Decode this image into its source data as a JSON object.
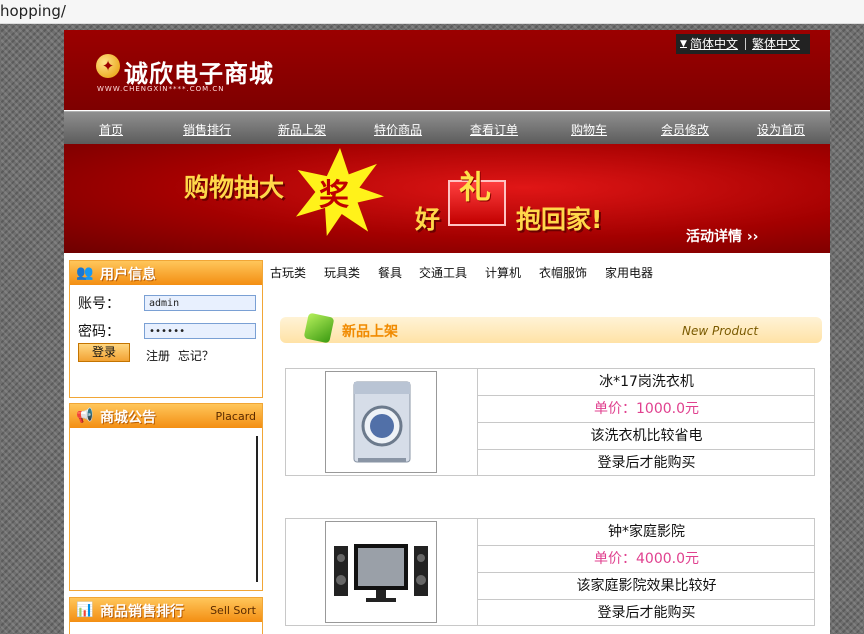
{
  "browser": {
    "url_fragment": "hopping/"
  },
  "header": {
    "logo_icon_glyph": "✦",
    "logo_text": "诚欣电子商城",
    "logo_sub": "WWW.CHENGXIN****.COM.CN",
    "lang_simplified": "简体中文",
    "lang_traditional": "繁体中文"
  },
  "nav": [
    "首页",
    "销售排行",
    "新品上架",
    "特价商品",
    "查看订单",
    "购物车",
    "会员修改",
    "设为首页"
  ],
  "banner": {
    "text1": "购物抽大",
    "star_text": "奖",
    "text2a": "好",
    "gift_word": "礼",
    "text2b": "抱回家!",
    "more": "活动详情 ››"
  },
  "user_box": {
    "title": "用户信息",
    "account_label": "账号：",
    "account_value": "admin",
    "password_label": "密码：",
    "password_value": "••••••",
    "login_button": "登录",
    "register_link": "注册",
    "forgot_link": "忘记？"
  },
  "notice_box": {
    "title": "商城公告",
    "title_en": "Placard"
  },
  "rank_box": {
    "title": "商品销售排行",
    "title_en": "Sell Sort"
  },
  "categories": [
    "古玩类",
    "玩具类",
    "餐具",
    "交通工具",
    "计算机",
    "衣帽服饰",
    "家用电器"
  ],
  "new_section": {
    "title": "新品上架",
    "title_en": "New Product"
  },
  "products": [
    {
      "name": "冰*17岗洗衣机",
      "price": "单价：1000.0元",
      "desc": "该洗衣机比较省电",
      "note": "登录后才能购买",
      "image_icon": "washing-machine"
    },
    {
      "name": "钟*家庭影院",
      "price": "单价：4000.0元",
      "desc": "该家庭影院效果比较好",
      "note": "登录后才能购买",
      "image_icon": "home-theater"
    }
  ],
  "colors": {
    "header_red": "#9b0000",
    "nav_gray": "#7a7a7a",
    "accent_orange": "#f38e12",
    "price_pink": "#e0418f"
  }
}
